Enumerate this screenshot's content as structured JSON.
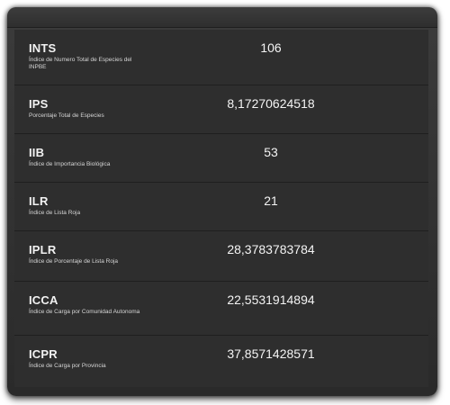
{
  "rows": [
    {
      "code": "INTS",
      "description": "Índice de Numero Total de Especies del INPBE",
      "value": "106"
    },
    {
      "code": "IPS",
      "description": "Porcentaje Total de Especies",
      "value": "8,17270624518"
    },
    {
      "code": "IIB",
      "description": "Índice de Importancia Biológica",
      "value": "53"
    },
    {
      "code": "ILR",
      "description": "Índice de Lista Roja",
      "value": "21"
    },
    {
      "code": "IPLR",
      "description": "Índice de Porcentaje de Lista Roja",
      "value": "28,3783783784"
    },
    {
      "code": "ICCA",
      "description": "Índice de Carga por Comunidad Autonoma",
      "value": "22,5531914894"
    },
    {
      "code": "ICPR",
      "description": "Índice de Carga por Provincia",
      "value": "37,8571428571"
    }
  ]
}
